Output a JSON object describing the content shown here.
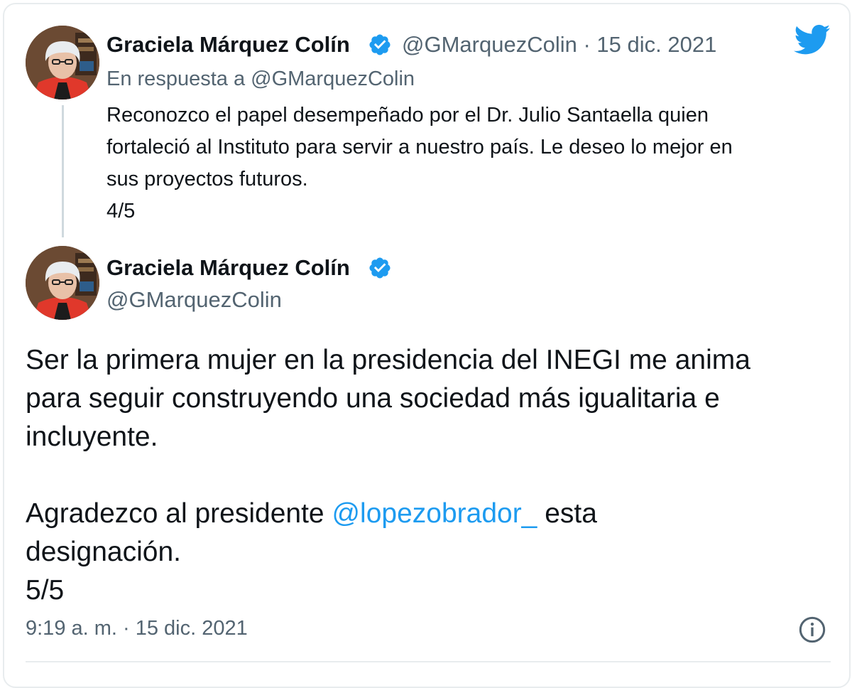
{
  "colors": {
    "accent": "#1d9bf0",
    "verified": "#1d9bf0",
    "secondary_text": "#536471",
    "primary_text": "#0f1419"
  },
  "reply_tweet": {
    "author_name": "Graciela Márquez Colín",
    "author_handle": "@GMarquezColin",
    "separator": "·",
    "date": "15 dic. 2021",
    "in_reply_to": "En respuesta a @GMarquezColin",
    "text_lines": [
      "Reconozco el papel desempeñado por el Dr. Julio Santaella quien",
      "fortaleció al Instituto para servir a nuestro país. Le deseo lo mejor en",
      "sus proyectos futuros."
    ],
    "counter": "4/5"
  },
  "main_tweet": {
    "author_name": "Graciela Márquez Colín",
    "author_handle": "@GMarquezColin",
    "paragraph1_lines": [
      "Ser la primera mujer en la presidencia del INEGI me anima",
      "para seguir construyendo una sociedad más igualitaria e",
      "incluyente."
    ],
    "paragraph2_before": "Agradezco al presidente ",
    "mention": "@lopezobrador_",
    "paragraph2_after": " esta",
    "paragraph2_line2": "designación.",
    "counter": "5/5",
    "timestamp": "9:19 a. m. · 15 dic. 2021"
  },
  "icons": {
    "verified": "verified-badge-icon",
    "logo": "twitter-bird-icon",
    "info": "info-icon",
    "avatar": "profile-photo"
  }
}
